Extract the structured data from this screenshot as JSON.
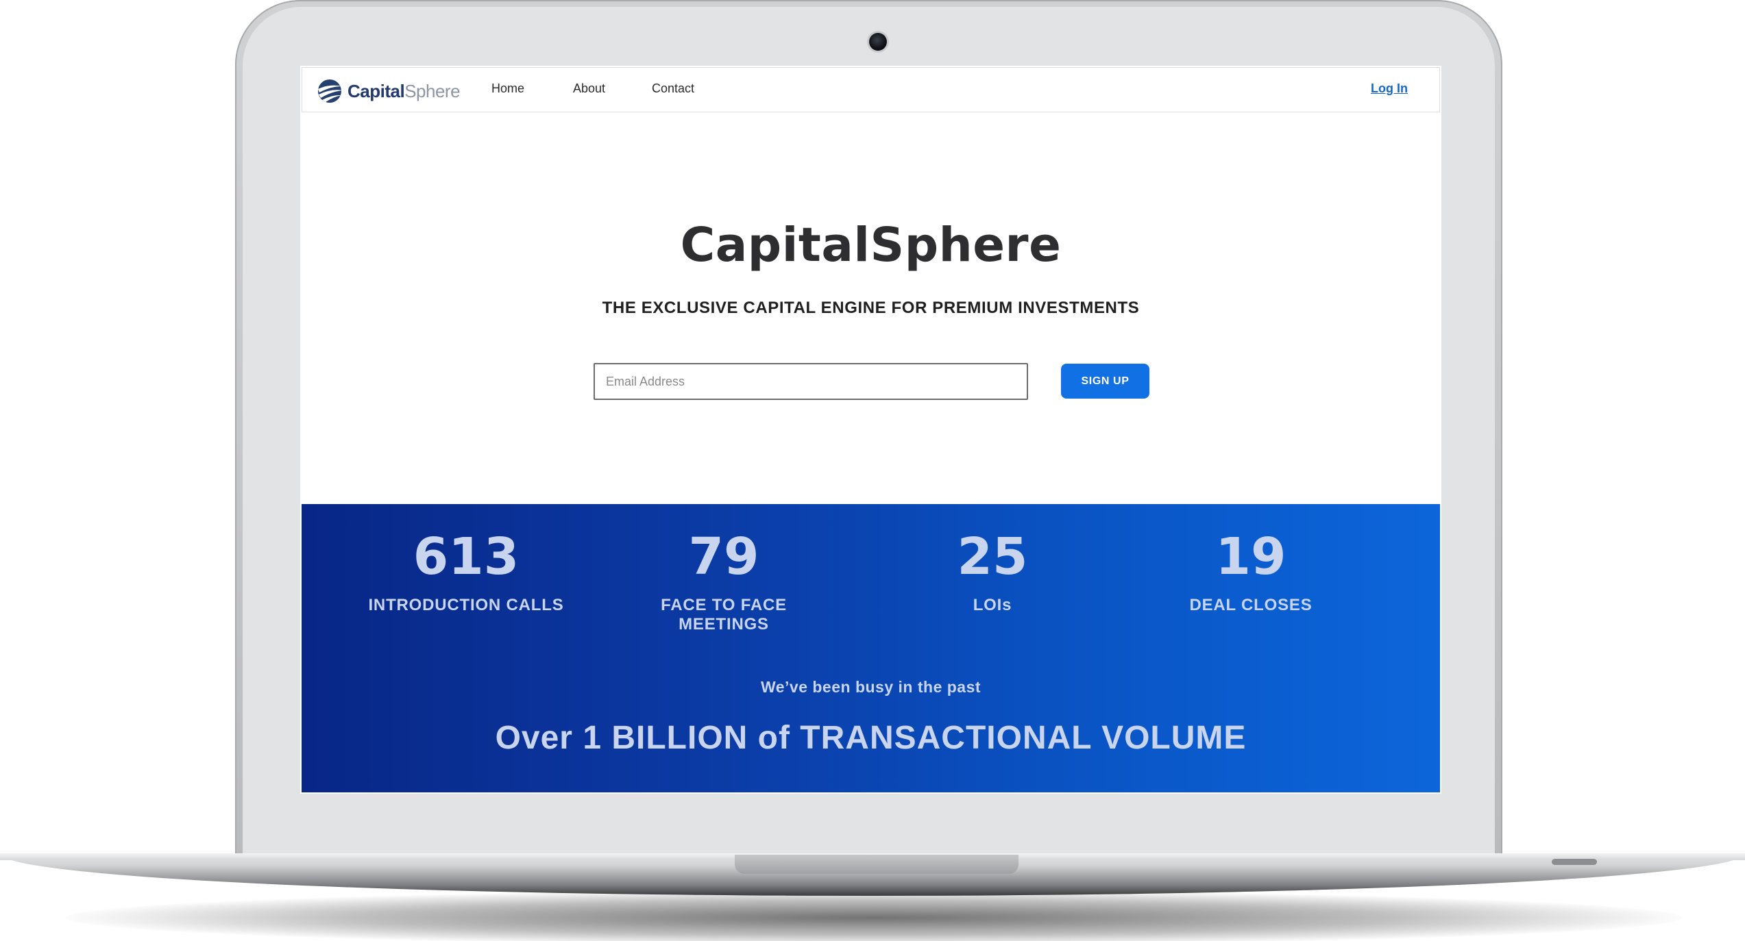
{
  "brand": {
    "logo_bold": "Capital",
    "logo_light": "Sphere",
    "logo_icon": "globe-swoosh-icon"
  },
  "nav": {
    "links": [
      "Home",
      "About",
      "Contact"
    ],
    "login": "Log In"
  },
  "hero": {
    "title": "CapitalSphere",
    "subtitle": "THE EXCLUSIVE CAPITAL ENGINE FOR PREMIUM INVESTMENTS",
    "email_placeholder": "Email Address",
    "signup_label": "SIGN UP"
  },
  "stats": [
    {
      "value": "613",
      "label": "INTRODUCTION CALLS"
    },
    {
      "value": "79",
      "label": "FACE TO FACE MEETINGS"
    },
    {
      "value": "25",
      "label": "LOIs"
    },
    {
      "value": "19",
      "label": "DEAL CLOSES"
    }
  ],
  "band": {
    "tagline": "We’ve been busy in the past",
    "headline": "Over 1 BILLION of TRANSACTIONAL VOLUME"
  },
  "colors": {
    "accent": "#1170e4",
    "band_start": "#082686",
    "band_end": "#0c66da",
    "stat_text": "#c9d5ee",
    "logo_navy": "#223a6e"
  }
}
